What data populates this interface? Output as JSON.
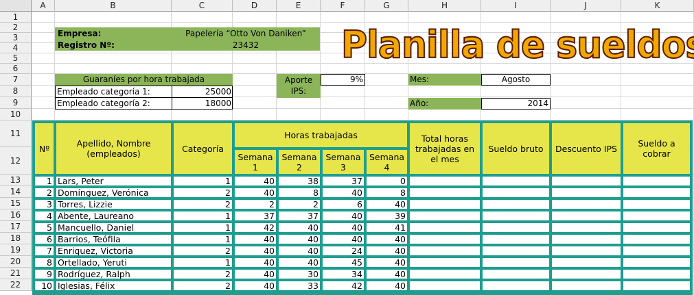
{
  "columns": [
    "A",
    "B",
    "C",
    "D",
    "E",
    "F",
    "G",
    "H",
    "I",
    "J",
    "K"
  ],
  "rows": [
    "1",
    "2",
    "3",
    "4",
    "5",
    "6",
    "7",
    "8",
    "9",
    "10",
    "11",
    "12",
    "13",
    "14",
    "15",
    "16",
    "17",
    "18",
    "19",
    "20",
    "21",
    "22"
  ],
  "company": {
    "label": "Empresa:",
    "value": "Papelería “Otto Von Daniken”"
  },
  "registry": {
    "label": "Registro Nº:",
    "value": "23432"
  },
  "title": "Planilla de sueldos",
  "rates": {
    "header": "Guaraníes por hora trabajada",
    "cat1_label": "Empleado categoría 1:",
    "cat1_value": "25000",
    "cat2_label": "Empleado categoría 2:",
    "cat2_value": "18000"
  },
  "ips": {
    "label": "Aporte IPS:",
    "value": "9%"
  },
  "month": {
    "label": "Mes:",
    "value": "Agosto"
  },
  "year": {
    "label": "Año:",
    "value": "2014"
  },
  "table_header": {
    "num": "Nº",
    "name": "Apellido, Nombre (empleados)",
    "category": "Categoría",
    "hours": "Horas trabajadas",
    "weeks": [
      "Semana 1",
      "Semana 2",
      "Semana 3",
      "Semana 4"
    ],
    "total_hours": "Total horas trabajadas en el mes",
    "gross": "Sueldo bruto",
    "ips_discount": "Descuento IPS",
    "net": "Sueldo a cobrar"
  },
  "employees": [
    {
      "n": "1",
      "name": "Lars, Peter",
      "cat": "1",
      "w": [
        "40",
        "38",
        "37",
        "0"
      ]
    },
    {
      "n": "2",
      "name": "Domínguez, Verónica",
      "cat": "2",
      "w": [
        "40",
        "8",
        "40",
        "8"
      ]
    },
    {
      "n": "3",
      "name": "Torres, Lizzie",
      "cat": "2",
      "w": [
        "2",
        "2",
        "6",
        "40"
      ]
    },
    {
      "n": "4",
      "name": "Abente, Laureano",
      "cat": "1",
      "w": [
        "37",
        "37",
        "40",
        "39"
      ]
    },
    {
      "n": "5",
      "name": "Mancuello, Daniel",
      "cat": "1",
      "w": [
        "42",
        "40",
        "40",
        "41"
      ]
    },
    {
      "n": "6",
      "name": "Barrios, Teófila",
      "cat": "1",
      "w": [
        "40",
        "40",
        "40",
        "40"
      ]
    },
    {
      "n": "7",
      "name": "Enriquez, Victoria",
      "cat": "2",
      "w": [
        "40",
        "40",
        "24",
        "40"
      ]
    },
    {
      "n": "8",
      "name": "Ortellado, Yeruti",
      "cat": "1",
      "w": [
        "40",
        "40",
        "45",
        "40"
      ]
    },
    {
      "n": "9",
      "name": "Rodríguez, Ralph",
      "cat": "2",
      "w": [
        "40",
        "30",
        "34",
        "40"
      ]
    },
    {
      "n": "10",
      "name": "Iglesias, Félix",
      "cat": "2",
      "w": [
        "40",
        "33",
        "42",
        "40"
      ]
    }
  ]
}
